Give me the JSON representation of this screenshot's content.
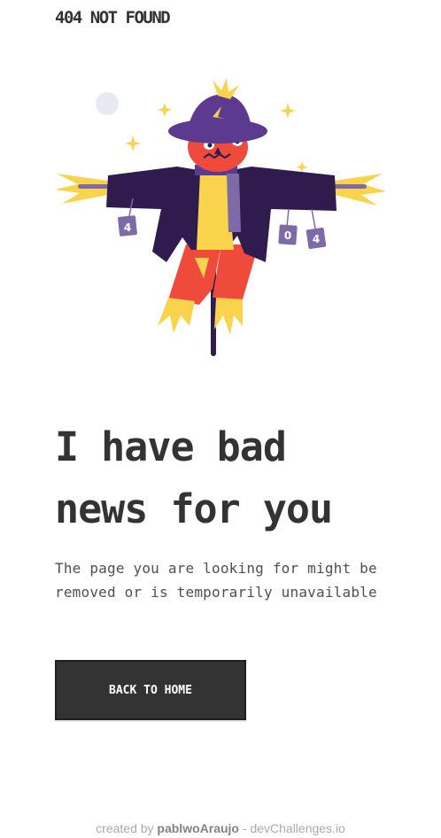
{
  "header": {
    "brand": "404 NOT FOUND"
  },
  "illustration": {
    "tag_left": "4",
    "tag_middle": "0",
    "tag_right": "4"
  },
  "main": {
    "headline_line1": "I have bad",
    "headline_line2": "news for you",
    "message": "The page you are looking for might be removed or is temporarily unavailable",
    "button_label": "BACK TO HOME"
  },
  "footer": {
    "prefix": "created by ",
    "author": "pablwoAraujo",
    "separator": " - ",
    "site": "devChallenges.io"
  },
  "colors": {
    "text_dark": "#333333",
    "button_bg": "#333333",
    "button_text": "#ffffff",
    "coat": "#2f1b4e",
    "hat": "#5b3a8f",
    "face": "#ef4b3c",
    "straw": "#f8d34b",
    "tag": "#7e6aa6"
  }
}
